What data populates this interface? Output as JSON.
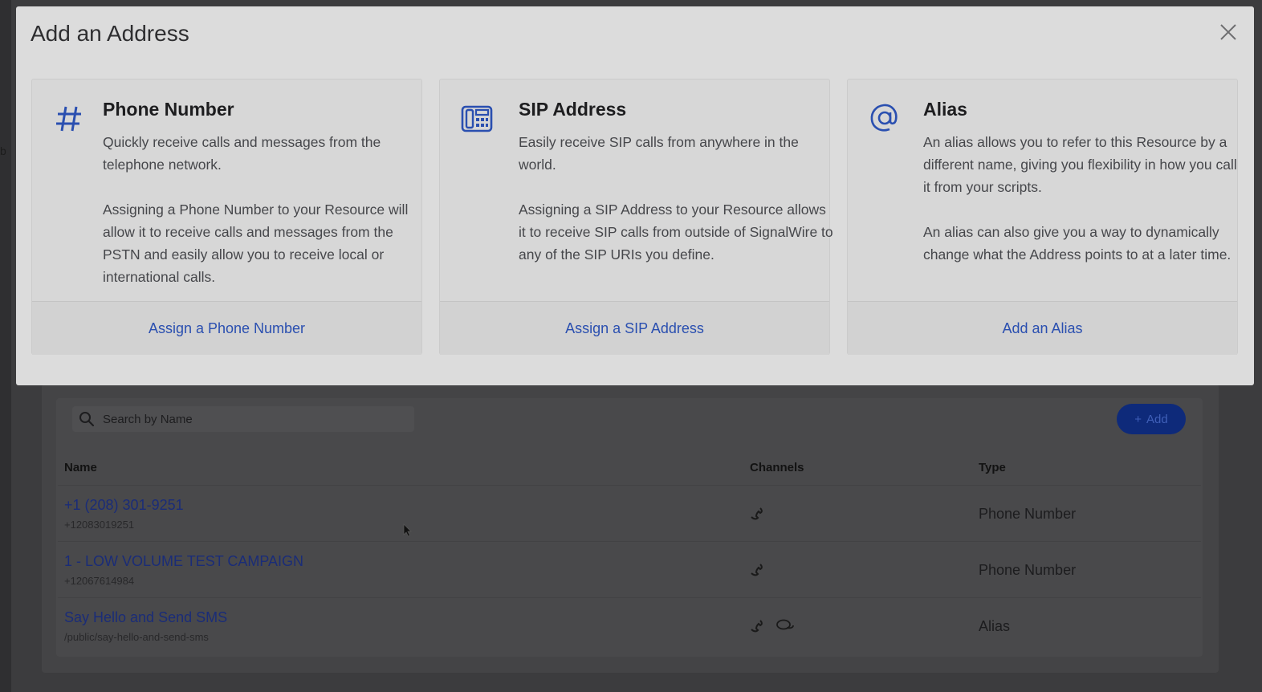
{
  "modal": {
    "title": "Add an Address",
    "cards": [
      {
        "icon": "hash-icon",
        "title": "Phone Number",
        "paragraphs": [
          "Quickly receive calls and messages from the telephone network.",
          "Assigning a Phone Number to your Resource will allow it to receive calls and messages from the PSTN and easily allow you to receive local or international calls."
        ],
        "action": "Assign a Phone Number"
      },
      {
        "icon": "fax-machine-icon",
        "title": "SIP Address",
        "paragraphs": [
          "Easily receive SIP calls from anywhere in the world.",
          "Assigning a SIP Address to your Resource allows it to receive SIP calls from outside of SignalWire to any of the SIP URIs you define."
        ],
        "action": "Assign a SIP Address"
      },
      {
        "icon": "at-sign-icon",
        "title": "Alias",
        "paragraphs": [
          "An alias allows you to refer to this Resource by a different name, giving you flexibility in how you call it from your scripts.",
          "An alias can also give you a way to dynamically change what the Address points to at a later time."
        ],
        "action": "Add an Alias"
      }
    ]
  },
  "background": {
    "search_placeholder": "Search by Name",
    "add_label": "Add",
    "columns": [
      "Name",
      "Channels",
      "Type"
    ],
    "rows": [
      {
        "name": "+1 (208) 301-9251",
        "sub": "+12083019251",
        "type": "Phone Number",
        "channels": [
          "phone-icon"
        ]
      },
      {
        "name": "1 - LOW VOLUME TEST CAMPAIGN",
        "sub": "+12067614984",
        "type": "Phone Number",
        "channels": [
          "phone-icon"
        ]
      },
      {
        "name": "Say Hello and Send SMS",
        "sub": "/public/say-hello-and-send-sms",
        "type": "Alias",
        "channels": [
          "phone-icon",
          "chat-icon"
        ]
      }
    ]
  },
  "colors": {
    "accent": "#2a4fb0",
    "overlay_button": "#0e2a7a",
    "modal_bg": "#dcdcdc"
  }
}
